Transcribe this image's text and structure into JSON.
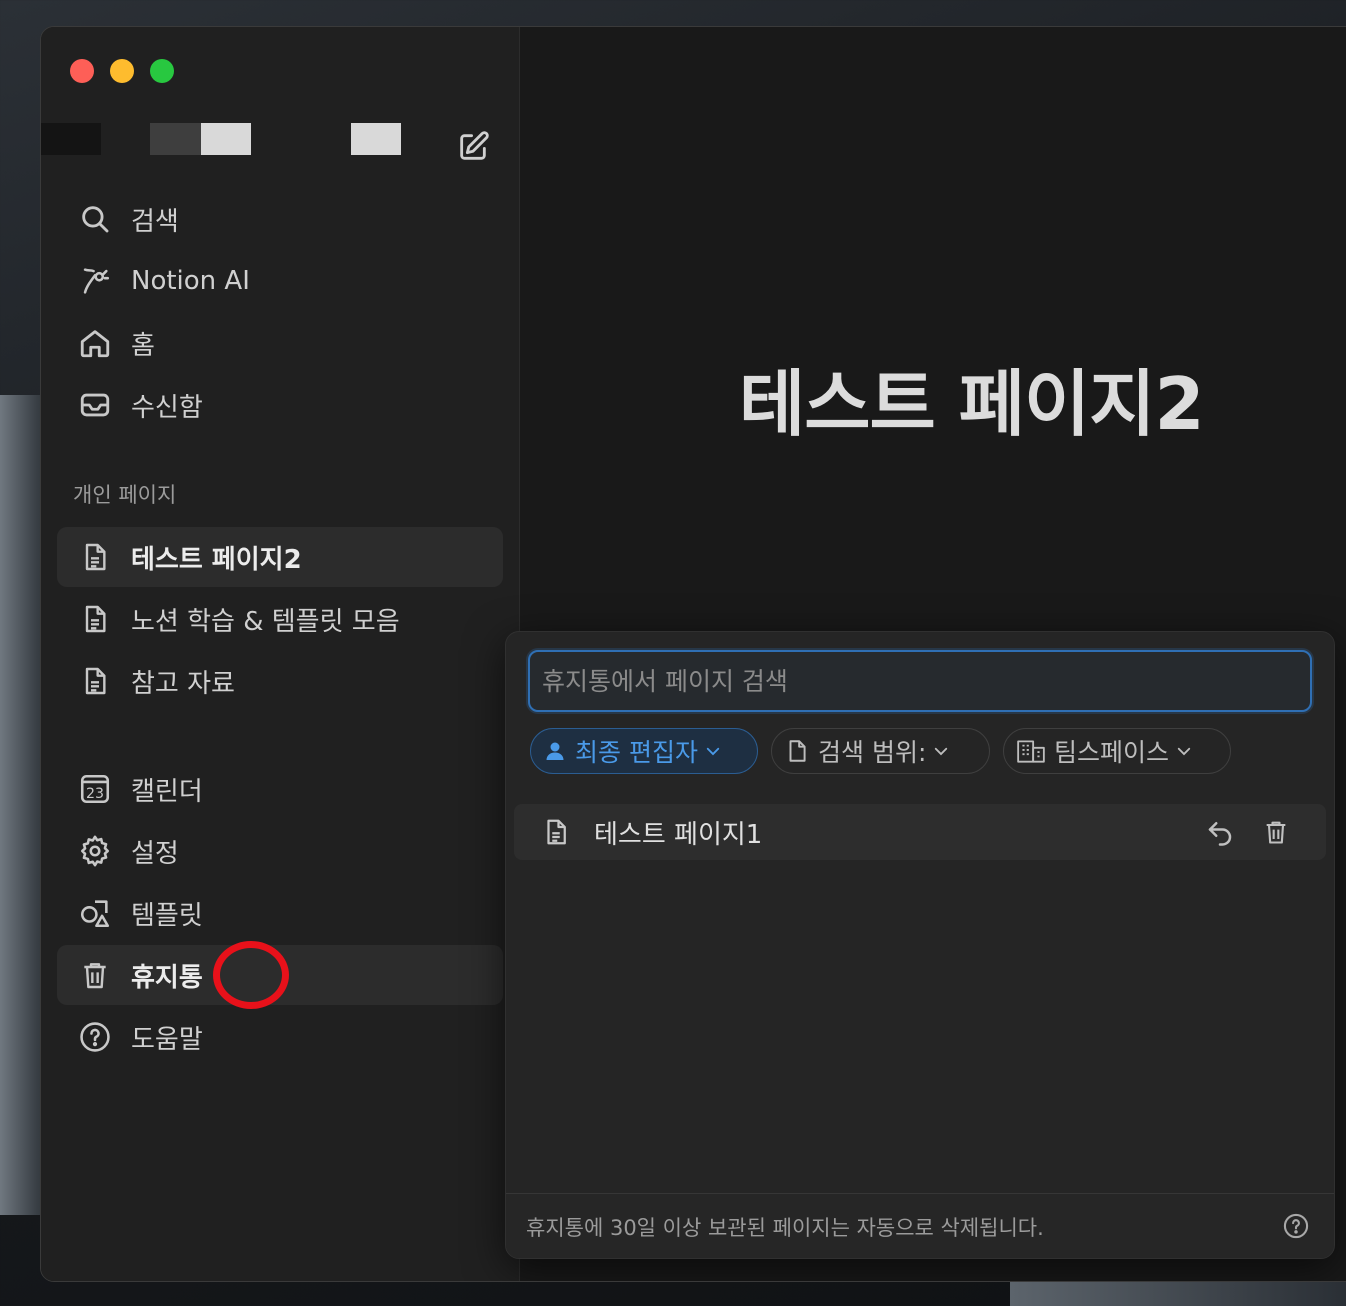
{
  "sidebar": {
    "nav": [
      {
        "label": "검색",
        "icon": "search-icon"
      },
      {
        "label": "Notion AI",
        "icon": "notion-ai-icon"
      },
      {
        "label": "홈",
        "icon": "home-icon"
      },
      {
        "label": "수신함",
        "icon": "inbox-icon"
      }
    ],
    "section_title": "개인 페이지",
    "pages": [
      {
        "label": "테스트 페이지2",
        "icon": "page-icon",
        "active": true
      },
      {
        "label": "노션 학습 & 템플릿 모음",
        "icon": "page-icon"
      },
      {
        "label": "참고 자료",
        "icon": "page-icon"
      }
    ],
    "tools": [
      {
        "label": "캘린더",
        "icon": "calendar-icon",
        "calendar_day": "23"
      },
      {
        "label": "설정",
        "icon": "gear-icon"
      },
      {
        "label": "템플릿",
        "icon": "template-icon"
      },
      {
        "label": "휴지통",
        "icon": "trash-icon",
        "active": true
      },
      {
        "label": "도움말",
        "icon": "help-icon"
      }
    ]
  },
  "main": {
    "page_title": "테스트 페이지2"
  },
  "trash": {
    "search_placeholder": "휴지통에서 페이지 검색",
    "filters": [
      {
        "label": "최종 편집자",
        "icon": "person-icon",
        "active": true
      },
      {
        "label": "검색 범위:",
        "icon": "page-icon"
      },
      {
        "label": "팀스페이스",
        "icon": "building-icon"
      }
    ],
    "items": [
      {
        "title": "테스트 페이지1",
        "icon": "page-icon"
      }
    ],
    "footer_text": "휴지통에 30일 이상 보관된 페이지는 자동으로 삭제됩니다."
  },
  "colors": {
    "accent_blue": "#2f6fb4",
    "annotation_red": "#e8111a"
  }
}
